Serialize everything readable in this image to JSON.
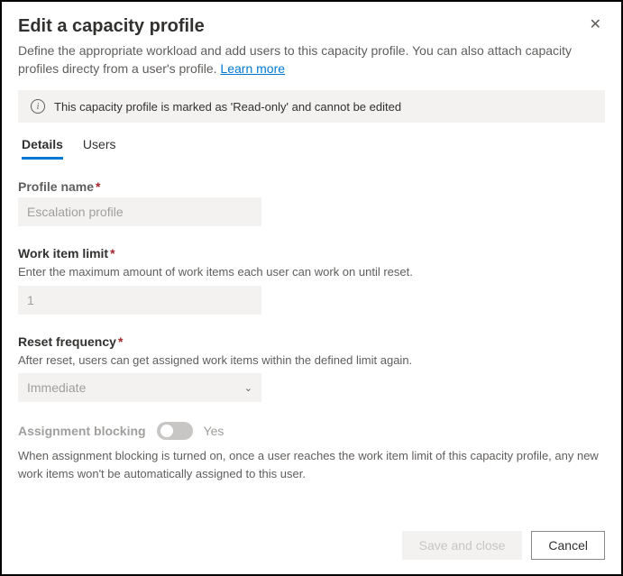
{
  "header": {
    "title": "Edit a capacity profile",
    "description_part1": "Define the appropriate workload and add users to this capacity profile. You can also attach capacity profiles directy from a user's profile. ",
    "learn_more": "Learn more"
  },
  "banner": {
    "text": "This capacity profile is marked as 'Read-only' and cannot be edited"
  },
  "tabs": {
    "details": "Details",
    "users": "Users"
  },
  "fields": {
    "profile_name": {
      "label": "Profile name",
      "value": "Escalation profile"
    },
    "work_item_limit": {
      "label": "Work item limit",
      "hint": "Enter the maximum amount of work items each user can work on until reset.",
      "value": "1"
    },
    "reset_frequency": {
      "label": "Reset frequency",
      "hint": "After reset, users can get assigned work items within the defined limit again.",
      "value": "Immediate"
    },
    "assignment_blocking": {
      "label": "Assignment blocking",
      "state": "Yes",
      "description": "When assignment blocking is turned on, once a user reaches the work item limit of this capacity profile, any new work items won't be automatically assigned to this user."
    }
  },
  "footer": {
    "save": "Save and close",
    "cancel": "Cancel"
  }
}
